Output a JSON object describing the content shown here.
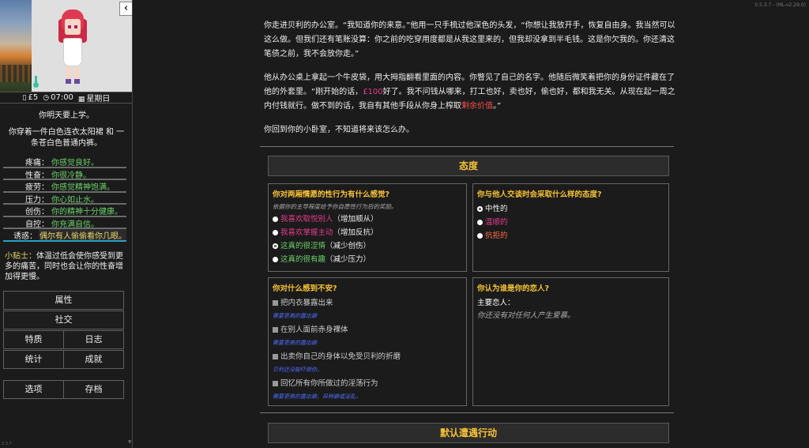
{
  "sidebar": {
    "collapse_icon": "chevron-left-icon",
    "status": {
      "money": "£5",
      "time": "07:00",
      "day": "星期日"
    },
    "day_text": "你明天要上学。",
    "outfit_text": "你穿着一件白色连衣太阳裙 和 一条苍白色普通内裤。",
    "stats": [
      {
        "label": "疼痛：",
        "value": "你感觉良好。"
      },
      {
        "label": "性奋：",
        "value": "你很冷静。"
      },
      {
        "label": "疲劳：",
        "value": "你感觉精神饱满。"
      },
      {
        "label": "压力：",
        "value": "你心如止水。"
      },
      {
        "label": "创伤：",
        "value": "你的精神十分健康。"
      },
      {
        "label": "自控：",
        "value": "你充满自信。"
      },
      {
        "label": "诱惑：",
        "value": "偶尔有人偷偷看你几眼。"
      }
    ],
    "tip": {
      "label": "小贴士：",
      "text": "体温过低会使你感受到更多的痛苦，同时也会让你的性奋增加得更慢。"
    },
    "menu": {
      "attributes": "属性",
      "social": "社交",
      "traits": "特质",
      "journal": "日志",
      "statistics": "统计",
      "achievements": "成就",
      "options": "选项",
      "saves": "存档"
    },
    "build": "0.3.7",
    "scroll_glyph": "▼"
  },
  "main": {
    "version": "0.5.3.7 - (ML-v2.29.0)",
    "passage": {
      "p1": "你走进贝利的办公室。“我知道你的来意。”他用一只手梳过他深色的头发，“你想让我放开手，恢复自由身。我当然可以这么做。但我们还有笔账没算：你之前的吃穿用度都是从我这里来的，但我却没拿到半毛钱。这是你欠我的。你还清这笔债之前，我不会放你走。”",
      "p2a": "他从办公桌上拿起一个牛皮袋，用大拇指翻看里面的内容。你瞥见了自己的名字。他随后微笑着把你的身份证件藏在了他的外套里。“刚开始的话，",
      "p2_money": "£100",
      "p2b": "好了。我不问钱从哪来，打工也好，卖也好，偷也好，都和我无关。从现在起一周之内付钱就行。做不到的话，我自有其他手段从你身上榨取",
      "p2_red": "剩余价值",
      "p2c": "。”",
      "p3": "你回到你的小卧室，不知道将来该怎么办。"
    },
    "attitude_header": "态度",
    "q1": {
      "title": "你对两厢情愿的性行为有什么感觉?",
      "subtitle": "依据你的主导程度给予你自愿性行为后的奖励。",
      "options": [
        {
          "text": "我喜欢取悦别人",
          "effect": "（增加顺从）"
        },
        {
          "text": "我喜欢掌握主动",
          "effect": "（增加反抗）"
        },
        {
          "text": "这真的很涩情",
          "effect": "（减少创伤）"
        },
        {
          "text": "这真的很有趣",
          "effect": "（减少压力）"
        }
      ]
    },
    "q2": {
      "title": "你与他人交谈时会采取什么样的态度?",
      "options": [
        "中性的",
        "温顺的",
        "抗拒的"
      ]
    },
    "q3": {
      "title": "你对什么感到不安?",
      "items": [
        {
          "text": "把内衣暴露出来",
          "note": "需要更高的露出癖"
        },
        {
          "text": "在别人面前赤身裸体",
          "note": "需要更高的露出癖"
        },
        {
          "text": "出卖你自己的身体以免受贝利的折磨",
          "note": "贝利还没能吓倒你。"
        },
        {
          "text": "回忆所有你所做过的淫荡行为",
          "note": "需要更高的露出癖、异种癖或淫乱。"
        }
      ]
    },
    "q4": {
      "title": "你认为谁是你的恋人?",
      "label": "主要恋人：",
      "none": "你还没有对任何人产生爱慕。"
    },
    "encounter_header": "默认遭遇行动"
  }
}
